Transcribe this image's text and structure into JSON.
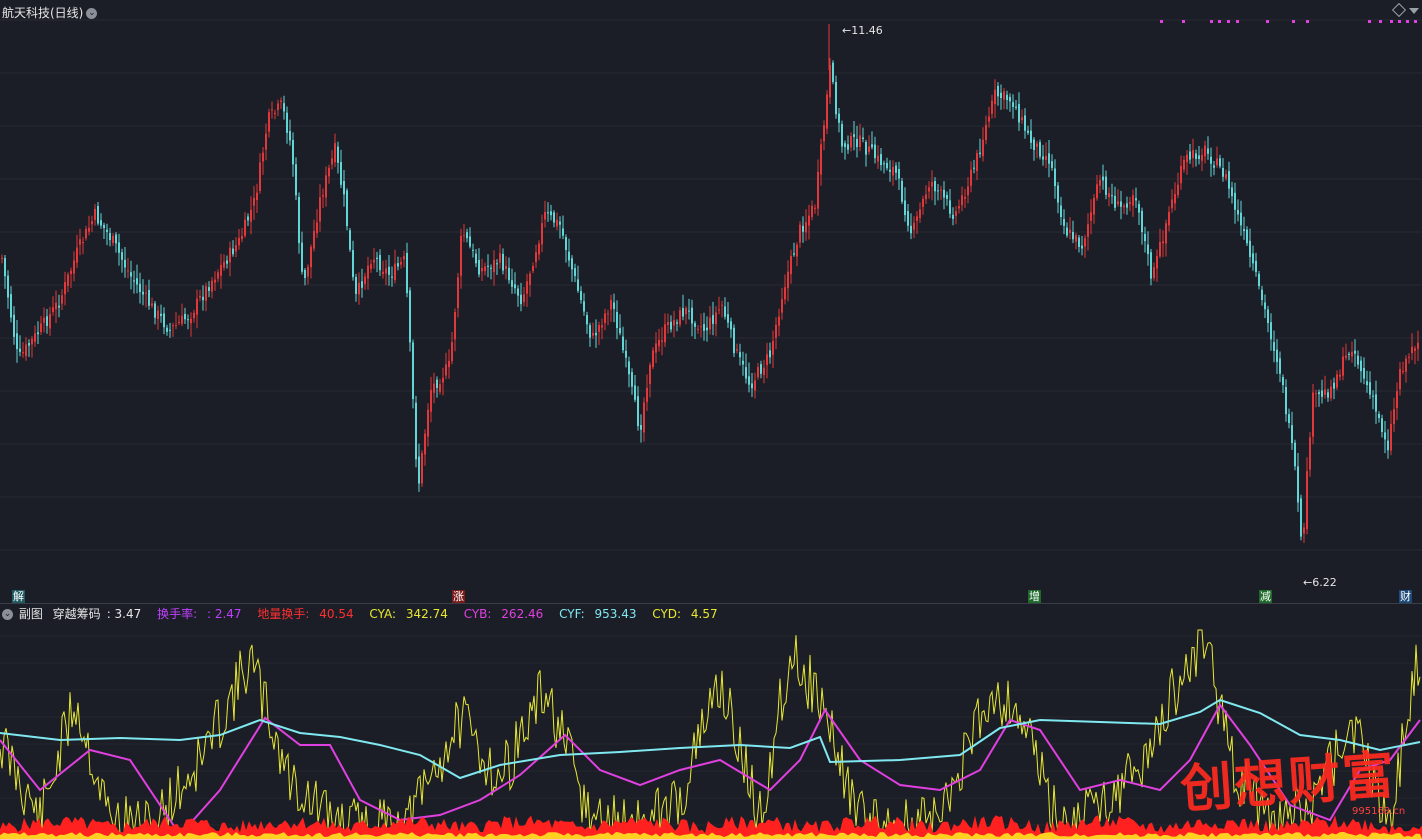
{
  "header": {
    "stock_title": "航天科技(日线)"
  },
  "chart_data": {
    "type": "candlestick",
    "main": {
      "high_label": "11.46",
      "low_label": "6.22",
      "price_range": [
        6.0,
        11.7
      ],
      "colors": {
        "up": "#e0383b",
        "down": "#62d6d6"
      }
    },
    "event_markers": [
      {
        "label": "解",
        "bg": "#1e5a60",
        "color": "#ffffff"
      },
      {
        "label": "涨",
        "bg": "#7a1a1a",
        "color": "#ffffff"
      },
      {
        "label": "增",
        "bg": "#1e6a2a",
        "color": "#ffffff"
      },
      {
        "label": "减",
        "bg": "#1e6a2a",
        "color": "#ffffff"
      },
      {
        "label": "财",
        "bg": "#1e4a7a",
        "color": "#ffffff"
      }
    ],
    "sub_indicator": {
      "panel_label": "副图",
      "name": "穿越筹码",
      "value": "3.47",
      "items": [
        {
          "label": "换手率:",
          "value": "2.47",
          "color": "#c040ff"
        },
        {
          "label": "地量换手:",
          "value": "40.54",
          "color": "#ff3030"
        },
        {
          "label": "CYA:",
          "value": "342.74",
          "color": "#e8e830"
        },
        {
          "label": "CYB:",
          "value": "262.46",
          "color": "#e040e0"
        },
        {
          "label": "CYF:",
          "value": "953.43",
          "color": "#80e8f0"
        },
        {
          "label": "CYD:",
          "value": "4.57",
          "color": "#e8e830"
        }
      ]
    }
  },
  "watermark": {
    "text": "创想财富",
    "site": "995168.cn"
  }
}
